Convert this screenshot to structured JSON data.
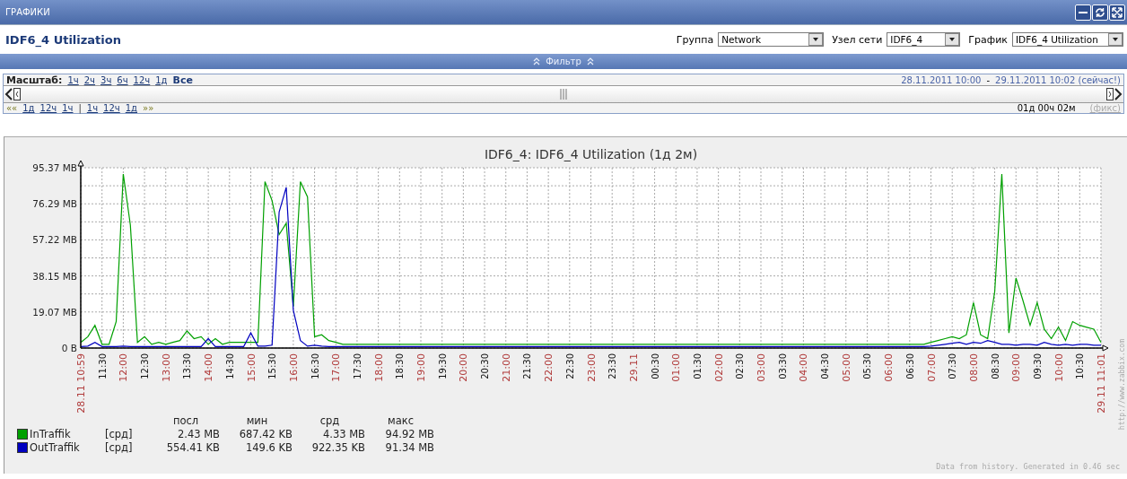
{
  "window": {
    "title": "ГРАФИКИ"
  },
  "header": {
    "title": "IDF6_4 Utilization",
    "filters": [
      {
        "label": "Группа",
        "value": "Network"
      },
      {
        "label": "Узел сети",
        "value": "IDF6_4"
      },
      {
        "label": "График",
        "value": "IDF6_4 Utilization"
      }
    ]
  },
  "filter_bar": {
    "label": "Фильтр"
  },
  "timeline": {
    "zoom_label": "Масштаб:",
    "zoom_options": [
      {
        "label": "1ч",
        "selected": false
      },
      {
        "label": "2ч",
        "selected": false
      },
      {
        "label": "3ч",
        "selected": false
      },
      {
        "label": "6ч",
        "selected": false
      },
      {
        "label": "12ч",
        "selected": false
      },
      {
        "label": "1д",
        "selected": false
      },
      {
        "label": "Все",
        "selected": true
      }
    ],
    "from": "28.11.2011 10:00",
    "separator": "-",
    "to": "29.11.2011 10:02",
    "now_note": "(сейчас!)",
    "back_arrow": "««",
    "back_steps": [
      "1д",
      "12ч",
      "1ч"
    ],
    "divider": "|",
    "forward_steps": [
      "1ч",
      "12ч",
      "1д"
    ],
    "forward_arrow": "»»",
    "period": "01д 00ч 02м",
    "selection": {
      "level": 1
    },
    "fix_label": "(фикс)"
  },
  "graph": {
    "chart_data": {
      "type": "line",
      "title": "IDF6_4: IDF6_4 Utilization  (1д 2м)",
      "categories": [
        "28.11 10:59",
        null,
        null,
        "11:30",
        null,
        null,
        "12:00",
        null,
        null,
        "12:30",
        null,
        null,
        "13:00",
        null,
        null,
        "13:30",
        null,
        null,
        "14:00",
        null,
        null,
        "14:30",
        null,
        null,
        "15:00",
        null,
        null,
        "15:30",
        null,
        null,
        "16:00",
        null,
        null,
        "16:30",
        null,
        null,
        "17:00",
        null,
        null,
        "17:30",
        null,
        null,
        "18:00",
        null,
        null,
        "18:30",
        null,
        null,
        "19:00",
        null,
        null,
        "19:30",
        null,
        null,
        "20:00",
        null,
        null,
        "20:30",
        null,
        null,
        "21:00",
        null,
        null,
        "21:30",
        null,
        null,
        "22:00",
        null,
        null,
        "22:30",
        null,
        null,
        "23:00",
        null,
        null,
        "23:30",
        null,
        null,
        "29.11",
        null,
        null,
        "00:30",
        null,
        null,
        "01:00",
        null,
        null,
        "01:30",
        null,
        null,
        "02:00",
        null,
        null,
        "02:30",
        null,
        null,
        "03:00",
        null,
        null,
        "03:30",
        null,
        null,
        "04:00",
        null,
        null,
        "04:30",
        null,
        null,
        "05:00",
        null,
        null,
        "05:30",
        null,
        null,
        "06:00",
        null,
        null,
        "06:30",
        null,
        null,
        "07:00",
        null,
        null,
        "07:30",
        null,
        null,
        "08:00",
        null,
        null,
        "08:30",
        null,
        null,
        "09:00",
        null,
        null,
        "09:30",
        null,
        null,
        "10:00",
        null,
        null,
        "10:30",
        null,
        null,
        "29.11 11:01"
      ],
      "series": [
        {
          "name": "InTraffik",
          "color": "#00a000",
          "values": [
            3,
            6,
            12,
            2,
            2,
            14,
            92,
            65,
            3,
            6,
            2,
            3,
            2,
            3,
            4,
            9,
            5,
            6,
            2,
            5,
            2,
            3,
            3,
            3,
            3,
            3,
            88,
            78,
            60,
            66,
            22,
            88,
            80,
            6,
            7,
            4,
            3,
            2,
            2,
            2,
            2,
            2,
            2,
            2,
            2,
            2,
            2,
            2,
            2,
            2,
            2,
            2,
            2,
            2,
            2,
            2,
            2,
            2,
            2,
            2,
            2,
            2,
            2,
            2,
            2,
            2,
            2,
            2,
            2,
            2,
            2,
            2,
            2,
            2,
            2,
            2,
            2,
            2,
            2,
            2,
            2,
            2,
            2,
            2,
            2,
            2,
            2,
            2,
            2,
            2,
            2,
            2,
            2,
            2,
            2,
            2,
            2,
            2,
            2,
            2,
            2,
            2,
            2,
            2,
            2,
            2,
            2,
            2,
            2,
            2,
            2,
            2,
            2,
            2,
            2,
            2,
            2,
            2,
            2,
            2,
            3,
            4,
            5,
            6,
            5,
            7,
            24,
            7,
            5,
            30,
            92,
            8,
            37,
            25,
            12,
            24,
            10,
            5,
            11,
            4,
            14,
            12,
            11,
            10,
            3
          ]
        },
        {
          "name": "OutTraffik",
          "color": "#0000c0",
          "values": [
            0.8,
            1,
            3,
            0.8,
            0.8,
            0.8,
            1,
            0.8,
            0.8,
            0.8,
            0.8,
            0.8,
            0.8,
            0.8,
            0.8,
            0.8,
            0.8,
            0.8,
            5,
            0.8,
            0.8,
            0.8,
            0.8,
            0.8,
            8,
            1,
            1,
            1.5,
            72,
            85,
            20,
            4,
            1,
            1.5,
            1,
            0.8,
            0.8,
            0.8,
            0.8,
            0.8,
            0.8,
            0.8,
            0.8,
            0.8,
            0.8,
            0.8,
            0.8,
            0.8,
            0.8,
            0.8,
            0.8,
            0.8,
            0.8,
            0.8,
            0.8,
            0.8,
            0.8,
            0.8,
            0.8,
            0.8,
            0.8,
            0.8,
            0.8,
            0.8,
            0.8,
            0.8,
            0.8,
            0.8,
            0.8,
            0.8,
            0.8,
            0.8,
            0.8,
            0.8,
            0.8,
            0.8,
            0.8,
            0.8,
            0.8,
            0.8,
            0.8,
            0.8,
            0.8,
            0.8,
            0.8,
            0.8,
            0.8,
            0.8,
            0.8,
            0.8,
            0.8,
            0.8,
            0.8,
            0.8,
            0.8,
            0.8,
            0.8,
            0.8,
            0.8,
            0.8,
            0.8,
            0.8,
            0.8,
            0.8,
            0.8,
            0.8,
            0.8,
            0.8,
            0.8,
            0.8,
            0.8,
            0.8,
            0.8,
            0.8,
            0.8,
            0.8,
            0.8,
            0.8,
            0.8,
            0.8,
            1,
            1.5,
            2,
            2.5,
            3,
            2,
            3,
            2.5,
            4,
            3,
            2,
            2,
            1.5,
            2,
            2,
            1.5,
            3,
            2,
            1.5,
            2,
            1.5,
            2,
            2,
            1.5,
            1.5
          ]
        }
      ],
      "ylim": [
        0,
        95.37
      ],
      "grid": true,
      "yticks": [
        {
          "value": 0,
          "label": "0 B"
        },
        {
          "value": 19.07,
          "label": "19.07 MB"
        },
        {
          "value": 38.15,
          "label": "38.15 MB"
        },
        {
          "value": 57.22,
          "label": "57.22 MB"
        },
        {
          "value": 76.29,
          "label": "76.29 MB"
        },
        {
          "value": 95.37,
          "label": "95.37 MB"
        }
      ]
    },
    "legend": {
      "columns": [
        "посл",
        "мин",
        "срд",
        "макс"
      ],
      "rows": [
        {
          "function": "[срд]",
          "values": [
            "2.43 MB",
            "687.42 KB",
            "4.33 MB",
            "94.92 MB"
          ]
        },
        {
          "function": "[срд]",
          "values": [
            "554.41 KB",
            "149.6 KB",
            "922.35 KB",
            "91.34 MB"
          ]
        }
      ]
    },
    "footer": "Data from history. Generated in 0.46 sec",
    "credit": "http://www.zabbix.com"
  }
}
